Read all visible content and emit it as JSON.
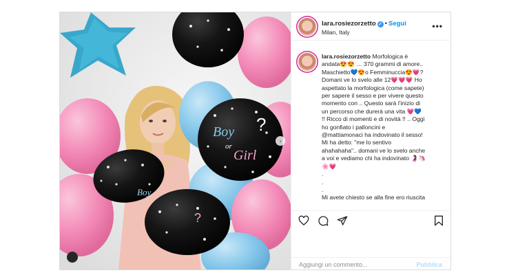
{
  "post": {
    "username": "lara.rosiezorzetto",
    "separator": "•",
    "follow_label": "Segui",
    "location": "Milan, Italy",
    "more_label": "•••",
    "verified_mark": "✓",
    "caption_username": "lara.rosiezorzetto",
    "caption_lines": [
      " Morfologica è",
      "andata😍😍 … 370 grammi di amore..",
      "Maschietto💙😍o Femminuccia😍💗?",
      "Domani ve lo svelo alle 12💗💗💗 Ho",
      "aspettato la morfologica (come sapete)",
      "per sapere il sesso e per vivere questo",
      "momento con .. Questo sarà l'inizio di",
      "un percorso che durerà una vita 💗💙",
      "!! Ricco di momenti e di novità !! .. Oggi",
      "ho gonfiato i palloncini e",
      "@mattiamonaci ha indovinato il sesso!",
      "Mi ha detto: \"me lo sentivo",
      "ahahahaha\".. domani ve lo svelo anche",
      "a voi e vediamo chi ha indovinato 🤰🦄",
      "🌸💗",
      ".",
      ".",
      ".",
      "Mi avete chiesto se alla fine ero riuscita"
    ],
    "comment_placeholder": "Aggiungi un commento...",
    "publish_label": "Pubblica",
    "balloon_text_boy": "Boy",
    "balloon_text_or": "or",
    "balloon_text_girl": "Girl",
    "balloon_small_text": "Boy",
    "next_arrow": "›"
  },
  "colors": {
    "accent": "#0095f6",
    "verified": "#3897f0",
    "publish_disabled": "#b2dffc",
    "pink_balloon": "#f38ab7",
    "blue_balloon": "#86c7ea",
    "black_balloon": "#151515"
  }
}
